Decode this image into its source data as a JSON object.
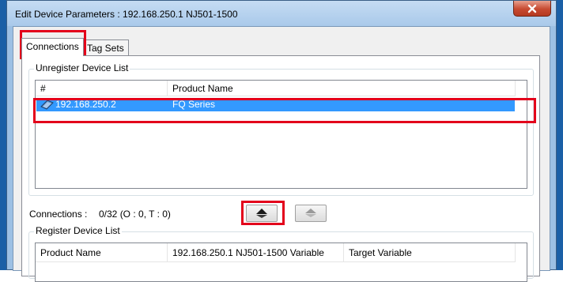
{
  "window": {
    "title": "Edit Device Parameters : 192.168.250.1 NJ501-1500"
  },
  "tabs": [
    {
      "label": "Connections",
      "active": true
    },
    {
      "label": "Tag Sets",
      "active": false
    }
  ],
  "unregister": {
    "group_label": "Unregister Device List",
    "columns": [
      "#",
      "Product Name"
    ],
    "rows": [
      {
        "address": "192.168.250.2",
        "product": "FQ Series",
        "icon": "device-icon",
        "selected": true
      }
    ]
  },
  "connections": {
    "label": "Connections :",
    "value": "0/32 (O : 0, T : 0)"
  },
  "buttons": {
    "register_icon": "move-down-arrow-icon",
    "unregister_icon": "move-up-arrow-icon"
  },
  "register": {
    "group_label": "Register Device List",
    "columns": [
      "Product Name",
      "192.168.250.1 NJ501-1500 Variable",
      "Target Variable"
    ]
  },
  "colors": {
    "selection": "#3399ff",
    "highlight": "#e3001b",
    "desktop": "#1a5fa6"
  }
}
